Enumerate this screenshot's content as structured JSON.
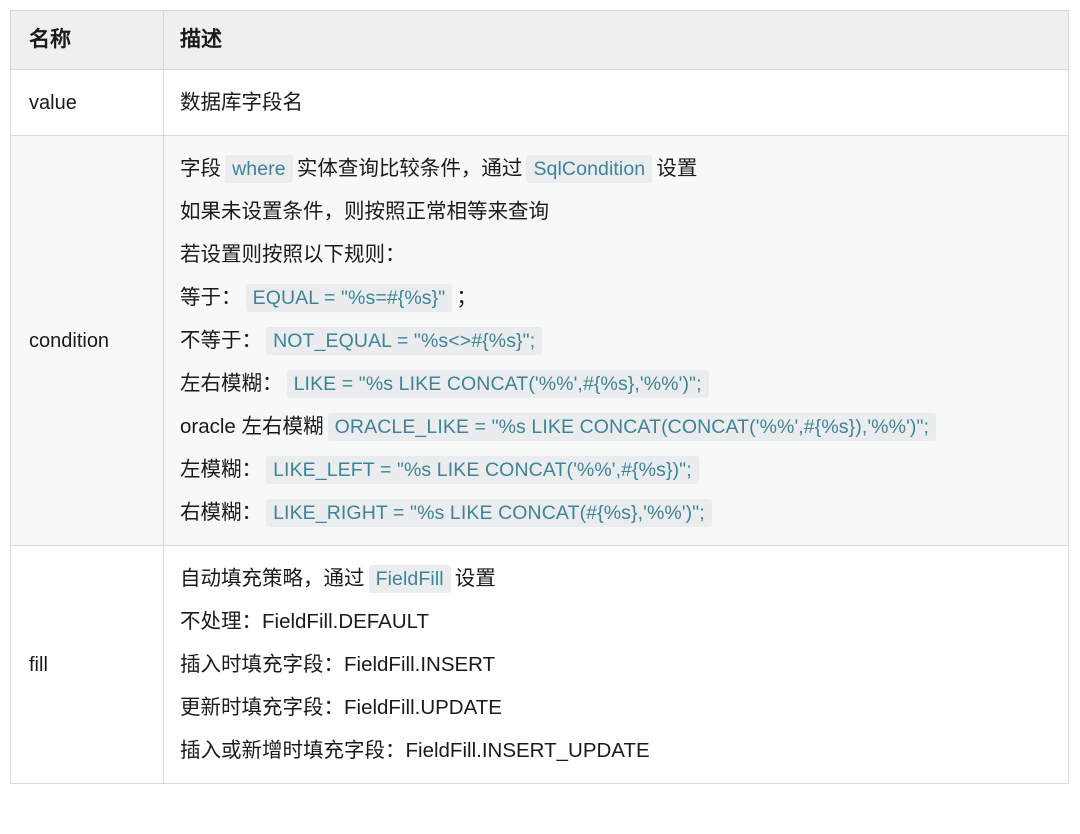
{
  "table": {
    "headers": [
      "名称",
      "描述"
    ],
    "rows": [
      {
        "name": "value",
        "tint": false,
        "lines": [
          {
            "parts": [
              {
                "type": "text",
                "text": "数据库字段名"
              }
            ]
          }
        ]
      },
      {
        "name": "condition",
        "tint": true,
        "lines": [
          {
            "parts": [
              {
                "type": "text",
                "text": "字段"
              },
              {
                "type": "code",
                "text": "where"
              },
              {
                "type": "text",
                "text": "实体查询比较条件，通过"
              },
              {
                "type": "code",
                "text": "SqlCondition"
              },
              {
                "type": "text",
                "text": "设置"
              }
            ]
          },
          {
            "parts": [
              {
                "type": "text",
                "text": "如果未设置条件，则按照正常相等来查询"
              }
            ]
          },
          {
            "parts": [
              {
                "type": "text",
                "text": "若设置则按照以下规则："
              }
            ]
          },
          {
            "parts": [
              {
                "type": "text",
                "text": "等于："
              },
              {
                "type": "code",
                "text": "EQUAL = \"%s=#{%s}\""
              },
              {
                "type": "text",
                "text": "；"
              }
            ]
          },
          {
            "parts": [
              {
                "type": "text",
                "text": "不等于："
              },
              {
                "type": "code",
                "text": "NOT_EQUAL = \"%s<>#{%s}\";"
              }
            ]
          },
          {
            "parts": [
              {
                "type": "text",
                "text": "左右模糊："
              },
              {
                "type": "code",
                "text": "LIKE = \"%s LIKE CONCAT('%%',#{%s},'%%')\";"
              }
            ]
          },
          {
            "parts": [
              {
                "type": "text",
                "text": "oracle 左右模糊"
              },
              {
                "type": "code",
                "text": "ORACLE_LIKE = \"%s LIKE CONCAT(CONCAT('%%',#{%s}),'%%')\";"
              }
            ]
          },
          {
            "parts": [
              {
                "type": "text",
                "text": "左模糊："
              },
              {
                "type": "code",
                "text": "LIKE_LEFT = \"%s LIKE CONCAT('%%',#{%s})\";"
              }
            ]
          },
          {
            "parts": [
              {
                "type": "text",
                "text": "右模糊："
              },
              {
                "type": "code",
                "text": "LIKE_RIGHT = \"%s LIKE CONCAT(#{%s},'%%')\";"
              }
            ]
          }
        ]
      },
      {
        "name": "fill",
        "tint": false,
        "lines": [
          {
            "parts": [
              {
                "type": "text",
                "text": "自动填充策略，通过"
              },
              {
                "type": "code",
                "text": "FieldFill"
              },
              {
                "type": "text",
                "text": "设置"
              }
            ]
          },
          {
            "parts": [
              {
                "type": "text",
                "text": "不处理：FieldFill.DEFAULT"
              }
            ]
          },
          {
            "parts": [
              {
                "type": "text",
                "text": "插入时填充字段：FieldFill.INSERT"
              }
            ]
          },
          {
            "parts": [
              {
                "type": "text",
                "text": "更新时填充字段：FieldFill.UPDATE"
              }
            ]
          },
          {
            "parts": [
              {
                "type": "text",
                "text": "插入或新增时填充字段：FieldFill.INSERT_UPDATE"
              }
            ]
          }
        ]
      }
    ]
  },
  "colors": {
    "header_bg": "#efefef",
    "row_tint_bg": "#f7f8f8",
    "border": "#d9d9d9",
    "code_bg": "#ebeced",
    "code_text": "#3d8498",
    "body_text": "#1a1a1a"
  }
}
